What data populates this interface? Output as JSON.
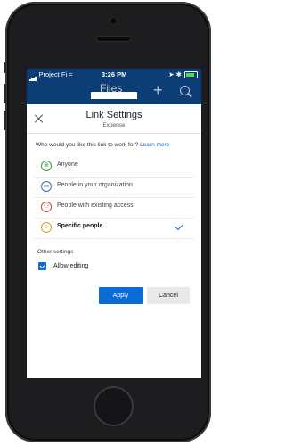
{
  "status_bar": {
    "carrier": "Project Fi",
    "time": "3:26 PM"
  },
  "app_header": {
    "title": "Files",
    "plus_icon": "plus-icon",
    "search_icon": "search-icon",
    "color": "#0c3d74"
  },
  "sheet": {
    "title": "Link Settings",
    "subtitle": "Expense",
    "question": "Who would you like this link to work for?",
    "learn_more": "Learn more",
    "options": [
      {
        "label": "Anyone",
        "icon": "globe-icon",
        "color": "#3a9a3a",
        "selected": false
      },
      {
        "label": "People in your organization",
        "icon": "building-icon",
        "color": "#2d6fb5",
        "selected": false
      },
      {
        "label": "People with existing access",
        "icon": "people-icon",
        "color": "#c0533a",
        "selected": false
      },
      {
        "label": "Specific people",
        "icon": "person-icon",
        "color": "#d99a1e",
        "selected": true
      }
    ],
    "other_settings_label": "Other settings",
    "allow_editing_label": "Allow editing",
    "allow_editing_checked": true,
    "apply_label": "Apply",
    "cancel_label": "Cancel",
    "accent": "#0a6bd6"
  }
}
